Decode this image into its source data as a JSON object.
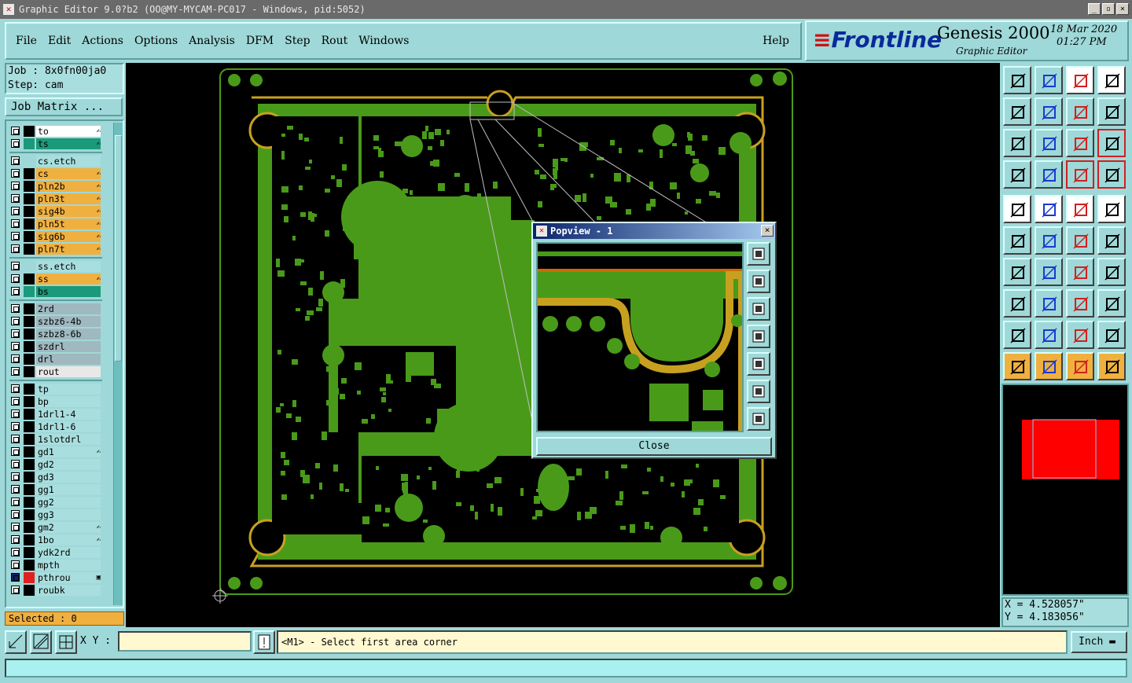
{
  "window": {
    "title": "Graphic Editor 9.0?b2 (OO@MY-MYCAM-PC017 - Windows, pid:5052)",
    "icon_name": "app-icon",
    "minimize": "_",
    "maximize": "▫",
    "close": "×"
  },
  "menu": {
    "items": [
      "File",
      "Edit",
      "Actions",
      "Options",
      "Analysis",
      "DFM",
      "Step",
      "Rout",
      "Windows"
    ],
    "help": "Help"
  },
  "brand": {
    "logo": "Frontline",
    "product": "Genesis 2000",
    "subtitle": "Graphic Editor",
    "date": "18 Mar 2020",
    "time": "01:27 PM"
  },
  "job": {
    "job_line": "Job : 8x0fn00ja0",
    "step_line": "Step: cam",
    "matrix_button": "Job Matrix ..."
  },
  "layers": [
    {
      "name": "to",
      "color": "#ffffff",
      "swatch": "#000000",
      "mark": "✍"
    },
    {
      "name": "ts",
      "color": "#1a9a7a",
      "swatch": "#1a9a7a",
      "mark": "✍"
    },
    {
      "name": "cs.etch",
      "color": "#a9dede",
      "swatch": "",
      "mark": ""
    },
    {
      "name": "cs",
      "color": "#f0b040",
      "swatch": "#000000",
      "mark": "✍"
    },
    {
      "name": "pln2b",
      "color": "#f0b040",
      "swatch": "#000000",
      "mark": "✍"
    },
    {
      "name": "pln3t",
      "color": "#f0b040",
      "swatch": "#000000",
      "mark": "✍"
    },
    {
      "name": "sig4b",
      "color": "#f0b040",
      "swatch": "#000000",
      "mark": "✍"
    },
    {
      "name": "pln5t",
      "color": "#f0b040",
      "swatch": "#000000",
      "mark": "✍"
    },
    {
      "name": "sig6b",
      "color": "#f0b040",
      "swatch": "#000000",
      "mark": "✍"
    },
    {
      "name": "pln7t",
      "color": "#f0b040",
      "swatch": "#000000",
      "mark": "✍"
    },
    {
      "name": "ss.etch",
      "color": "#a9dede",
      "swatch": "",
      "mark": ""
    },
    {
      "name": "ss",
      "color": "#f0b040",
      "swatch": "#000000",
      "mark": "✍"
    },
    {
      "name": "bs",
      "color": "#1a9a7a",
      "swatch": "#1a9a7a",
      "mark": ""
    },
    {
      "name": "2rd",
      "color": "#a0b8c0",
      "swatch": "#000000",
      "mark": ""
    },
    {
      "name": "szbz6-4b",
      "color": "#a0b8c0",
      "swatch": "#000000",
      "mark": ""
    },
    {
      "name": "szbz8-6b",
      "color": "#a0b8c0",
      "swatch": "#000000",
      "mark": ""
    },
    {
      "name": "szdrl",
      "color": "#a0b8c0",
      "swatch": "#000000",
      "mark": ""
    },
    {
      "name": "drl",
      "color": "#a0b8c0",
      "swatch": "#000000",
      "mark": ""
    },
    {
      "name": "rout",
      "color": "#e8e8e8",
      "swatch": "#000000",
      "mark": ""
    },
    {
      "name": "tp",
      "color": "#a9dede",
      "swatch": "#000000",
      "mark": ""
    },
    {
      "name": "bp",
      "color": "#a9dede",
      "swatch": "#000000",
      "mark": ""
    },
    {
      "name": "1drl1-4",
      "color": "#a9dede",
      "swatch": "#000000",
      "mark": ""
    },
    {
      "name": "1drl1-6",
      "color": "#a9dede",
      "swatch": "#000000",
      "mark": ""
    },
    {
      "name": "1slotdrl",
      "color": "#a9dede",
      "swatch": "#000000",
      "mark": ""
    },
    {
      "name": "gd1",
      "color": "#a9dede",
      "swatch": "#000000",
      "mark": "✍"
    },
    {
      "name": "gd2",
      "color": "#a9dede",
      "swatch": "#000000",
      "mark": ""
    },
    {
      "name": "gd3",
      "color": "#a9dede",
      "swatch": "#000000",
      "mark": ""
    },
    {
      "name": "gg1",
      "color": "#a9dede",
      "swatch": "#000000",
      "mark": ""
    },
    {
      "name": "gg2",
      "color": "#a9dede",
      "swatch": "#000000",
      "mark": ""
    },
    {
      "name": "gg3",
      "color": "#a9dede",
      "swatch": "#000000",
      "mark": ""
    },
    {
      "name": "gm2",
      "color": "#a9dede",
      "swatch": "#000000",
      "mark": "✍"
    },
    {
      "name": "1bo",
      "color": "#a9dede",
      "swatch": "#000000",
      "mark": "✍"
    },
    {
      "name": "ydk2rd",
      "color": "#a9dede",
      "swatch": "#000000",
      "mark": ""
    },
    {
      "name": "mpth",
      "color": "#a9dede",
      "swatch": "#000000",
      "mark": ""
    },
    {
      "name": "pthrou",
      "color": "#a9dede",
      "swatch": "#e02020",
      "mark": "▣"
    },
    {
      "name": "roubk",
      "color": "#a9dede",
      "swatch": "#000000",
      "mark": ""
    }
  ],
  "selected": "Selected : 0",
  "popview": {
    "title": "Popview - 1",
    "close_button": "Close",
    "close_icon": "×"
  },
  "coords": {
    "x": "X = 4.528057\"",
    "y": "Y = 4.183056\""
  },
  "bottom": {
    "xy_label": "X Y :",
    "xy_value": "",
    "message": "<M1> - Select first area corner",
    "units": "Inch"
  },
  "colors": {
    "board": "#4a9a1a",
    "outline": "#c8a020",
    "trace": "#d06a00",
    "ui": "#9fd8d8",
    "overview_red": "#ff0000"
  }
}
